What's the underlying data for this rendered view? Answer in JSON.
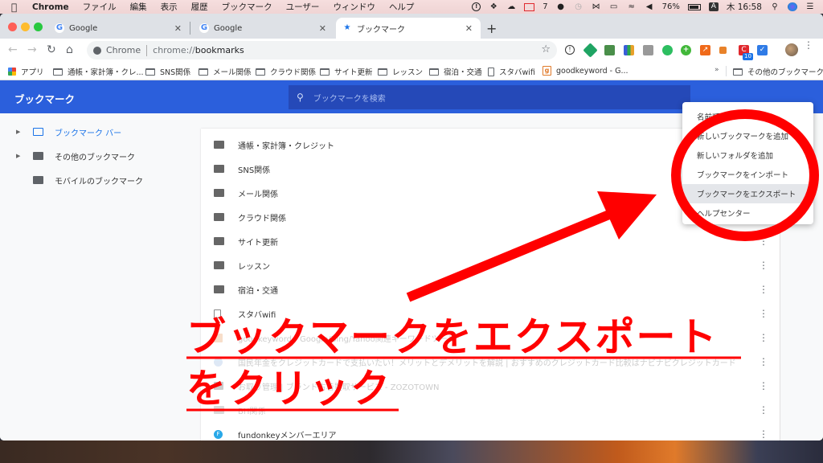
{
  "menubar": {
    "app_name": "Chrome",
    "items": [
      "ファイル",
      "編集",
      "表示",
      "履歴",
      "ブックマーク",
      "ユーザー",
      "ウィンドウ",
      "ヘルプ"
    ],
    "status": {
      "mail_count": "7",
      "battery": "76%",
      "input_mode": "A",
      "clock": "木 16:58"
    }
  },
  "tabs": [
    {
      "title": "Google",
      "favicon": "google-icon",
      "active": false
    },
    {
      "title": "Google",
      "favicon": "google-icon",
      "active": false
    },
    {
      "title": "ブックマーク",
      "favicon": "star-icon",
      "active": true
    }
  ],
  "toolbar": {
    "omnibox_scheme": "Chrome",
    "omnibox_url_prefix": "chrome://",
    "omnibox_url_host": "bookmarks",
    "extension_badge": "10"
  },
  "bookmarks_bar": {
    "items": [
      {
        "label": "アプリ",
        "icon": "apps-icon"
      },
      {
        "label": "通帳・家計簿・クレ...",
        "icon": "folder-icon"
      },
      {
        "label": "SNS関係",
        "icon": "folder-icon"
      },
      {
        "label": "メール関係",
        "icon": "folder-icon"
      },
      {
        "label": "クラウド関係",
        "icon": "folder-icon"
      },
      {
        "label": "サイト更新",
        "icon": "folder-icon"
      },
      {
        "label": "レッスン",
        "icon": "folder-icon"
      },
      {
        "label": "宿泊・交通",
        "icon": "folder-icon"
      },
      {
        "label": "スタバwifi",
        "icon": "page-icon"
      },
      {
        "label": "goodkeyword - G...",
        "icon": "goodkeyword-icon"
      }
    ],
    "overflow": "»",
    "other_bookmarks": "その他のブックマーク"
  },
  "bookmarks_page": {
    "title": "ブックマーク",
    "search_placeholder": "ブックマークを検索",
    "sidebar": [
      {
        "label": "ブックマーク バー",
        "selected": true,
        "expandable": true
      },
      {
        "label": "その他のブックマーク",
        "selected": false,
        "expandable": true
      },
      {
        "label": "モバイルのブックマーク",
        "selected": false,
        "expandable": false
      }
    ],
    "list": [
      {
        "label": "通帳・家計簿・クレジット",
        "type": "folder"
      },
      {
        "label": "SNS関係",
        "type": "folder"
      },
      {
        "label": "メール関係",
        "type": "folder"
      },
      {
        "label": "クラウド関係",
        "type": "folder"
      },
      {
        "label": "サイト更新",
        "type": "folder"
      },
      {
        "label": "レッスン",
        "type": "folder"
      },
      {
        "label": "宿泊・交通",
        "type": "folder"
      },
      {
        "label": "スタバwifi",
        "type": "page"
      },
      {
        "label": "goodkeyword - Google/Bing/Yahoo関連キーワードツール",
        "type": "site"
      },
      {
        "label": "国民年金をクレジットカードで支払いたい！メリットとデメリットを解説 | おすすめのクレジットカード比較はナビナビクレジットカード",
        "type": "site"
      },
      {
        "label": "お取り管理 | ブランド古着買取サービス - ZOZOTOWN",
        "type": "site"
      },
      {
        "label": "BH関係",
        "type": "folder"
      },
      {
        "label": "fundonkeyメンバーエリア",
        "type": "site"
      }
    ],
    "menu": [
      {
        "label": "名前順",
        "highlighted": false
      },
      {
        "label": "新しいブックマークを追加",
        "highlighted": false
      },
      {
        "label": "新しいフォルダを追加",
        "highlighted": false
      },
      {
        "label": "ブックマークをインポート",
        "highlighted": false
      },
      {
        "label": "ブックマークをエクスポート",
        "highlighted": true
      },
      {
        "label": "ヘルプセンター",
        "highlighted": false
      }
    ]
  },
  "annotation": {
    "line1": "ブックマークをエクスポート",
    "line2": "をクリック",
    "color": "#ff0000"
  },
  "colors": {
    "header_blue": "#2b5fdc",
    "accent_blue": "#1a73e8"
  }
}
